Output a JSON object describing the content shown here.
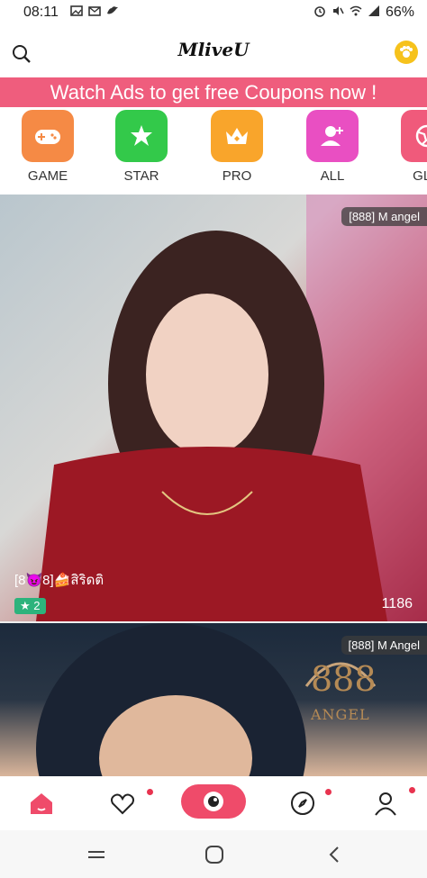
{
  "status_bar": {
    "time": "08:11",
    "battery": "66%"
  },
  "header": {
    "title": "MliveU"
  },
  "banner": {
    "text": "Watch Ads to get free Coupons now !"
  },
  "categories": [
    {
      "label": "GAME",
      "color": "#f58a45"
    },
    {
      "label": "STAR",
      "color": "#33c94a"
    },
    {
      "label": "PRO",
      "color": "#f9a52b"
    },
    {
      "label": "ALL",
      "color": "#e94fc2"
    },
    {
      "label": "GLO",
      "color": "#f05a7b"
    }
  ],
  "feed": [
    {
      "tag": "[888] M angel",
      "streamer": "[8😈8]🍰สิริดติ",
      "star": "★ 2",
      "viewers": "1186"
    },
    {
      "tag": "[888] M Angel",
      "logo_number": "888",
      "logo_text": "ANGEL"
    }
  ],
  "accent_color": "#ef5d7d"
}
